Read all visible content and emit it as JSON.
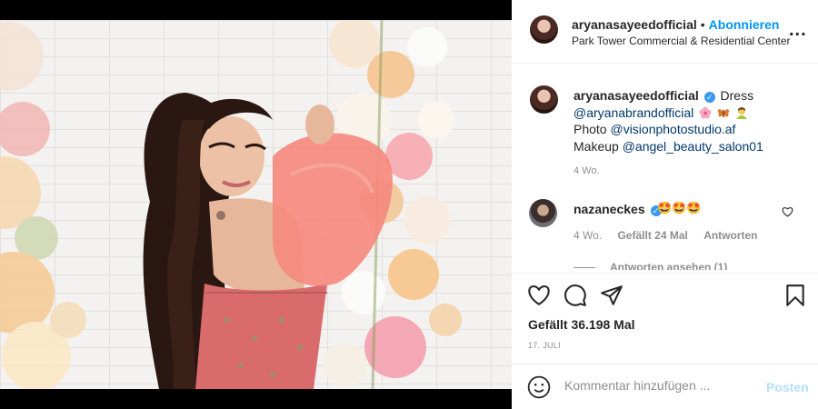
{
  "header": {
    "username": "aryanasayeedofficial",
    "separator": "•",
    "follow_label": "Abonnieren",
    "location": "Park Tower Commercial & Residential Center",
    "more": "..."
  },
  "caption": {
    "username": "aryanasayeedofficial",
    "verified": "✓",
    "line1_text": "Dress",
    "mention1": "@aryanabrandofficial",
    "photo_label": "Photo",
    "mention2": "@visionphotostudio.af",
    "makeup_label": "Makeup",
    "mention3": "@angel_beauty_salon01",
    "time": "4 Wo."
  },
  "comment": {
    "username": "nazaneckes",
    "verified": "✓",
    "text": "🤩🤩🤩",
    "time": "4 Wo.",
    "likes": "Gefällt 24 Mal",
    "reply_label": "Antworten",
    "view_replies": "Antworten ansehen (1)"
  },
  "actions": {
    "icons": [
      "heart-icon",
      "comment-icon",
      "share-icon",
      "bookmark-icon"
    ],
    "likes_text": "Gefällt 36.198 Mal",
    "date": "17. JULI"
  },
  "composer": {
    "placeholder": "Kommentar hinzufügen ...",
    "post_label": "Posten"
  },
  "colors": {
    "accent": "#0095f6",
    "post_disabled": "#b2dffc",
    "verified": "#3897f0",
    "dress_top": "#f58a7e"
  }
}
